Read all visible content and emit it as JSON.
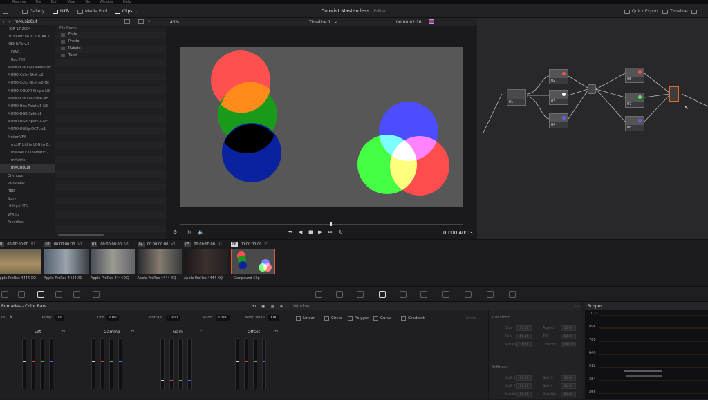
{
  "menubar": {
    "items": [
      "Resolve",
      "File",
      "Edit",
      "View",
      "Go",
      "Window",
      "Help"
    ]
  },
  "toolbar": {
    "gallery": "Gallery",
    "luts": "LUTs",
    "media_pool": "Media Pool",
    "clips": "Clips",
    "project_title": "Colorist Masterclass",
    "project_status": "Edited",
    "quick_export": "Quick Export",
    "timeline": "Timeline"
  },
  "lut_browser": {
    "folder": "mMusicCut",
    "column_header": "File Name",
    "tree": [
      {
        "label": "HGR 17.2084",
        "sub": false
      },
      {
        "label": "INTERMEDIATE KODAK 2...",
        "sub": false
      },
      {
        "label": "KB3 LUTs v.3",
        "sub": false
      },
      {
        "label": "DWG",
        "sub": true
      },
      {
        "label": "Rec.709",
        "sub": true
      },
      {
        "label": "MONO-COLOR-Double-NE",
        "sub": false
      },
      {
        "label": "MONO-Color-Shift-v2",
        "sub": false
      },
      {
        "label": "MONO-Color-Shift-v2-NE",
        "sub": false
      },
      {
        "label": "MONO-COLOR-Single-NE",
        "sub": false
      },
      {
        "label": "MONO-COLOR-Triple-NE",
        "sub": false
      },
      {
        "label": "MONO-Hue-Twist-v1-NE",
        "sub": false
      },
      {
        "label": "MONO-RGB-Split-v1",
        "sub": false
      },
      {
        "label": "MONO-RGB-Split-v1-NE",
        "sub": false
      },
      {
        "label": "MONO-Utility-DCTL-v1",
        "sub": false
      },
      {
        "label": "MotionVFX",
        "sub": false
      },
      {
        "label": "mLUT Utility LOG to 8...",
        "sub": true
      },
      {
        "label": "mMake it Cinematic 2...",
        "sub": true
      },
      {
        "label": "mMatrix",
        "sub": true
      },
      {
        "label": "mMusicCut",
        "sub": true,
        "selected": true
      },
      {
        "label": "Olympus",
        "sub": false
      },
      {
        "label": "Panasonic",
        "sub": false
      },
      {
        "label": "RED",
        "sub": false
      },
      {
        "label": "Sony",
        "sub": false
      },
      {
        "label": "Utility-LUTS",
        "sub": false
      },
      {
        "label": "VFX IO",
        "sub": false
      },
      {
        "label": "Favorites",
        "sub": false
      }
    ],
    "files": [
      "Forte",
      "Presto",
      "Rubato",
      "Tacet"
    ]
  },
  "viewer": {
    "zoom": "45%",
    "timeline_name": "Timeline 1",
    "timecode": "00:00:02:16",
    "playhead_timecode": "00:00:40:03"
  },
  "node_graph": {
    "nodes": [
      "01",
      "02",
      "03",
      "04",
      "05",
      "07",
      "08"
    ]
  },
  "clips": [
    {
      "num": "01",
      "tc": "00:00:00:00",
      "track": "V1",
      "codec": "Apple ProRes 4444 XQ"
    },
    {
      "num": "02",
      "tc": "00:00:00:00",
      "track": "V1",
      "codec": "Apple ProRes 4444 XQ"
    },
    {
      "num": "03",
      "tc": "00:00:00:00",
      "track": "V1",
      "codec": "Apple ProRes 4444 XQ"
    },
    {
      "num": "04",
      "tc": "00:00:00:00",
      "track": "V1",
      "codec": "Apple ProRes 4444 XQ"
    },
    {
      "num": "05",
      "tc": "00:00:00:00",
      "track": "V1",
      "codec": "Apple ProRes 4444 XQ"
    },
    {
      "num": "06",
      "tc": "00:00:00:00",
      "track": "V1",
      "codec": "Compound Clip"
    }
  ],
  "primaries": {
    "title": "Primaries - Color Bars",
    "params": [
      {
        "label": "Temp",
        "value": "0.0"
      },
      {
        "label": "Tint",
        "value": "0.00"
      },
      {
        "label": "Contrast",
        "value": "1.000"
      },
      {
        "label": "Pivot",
        "value": "0.000"
      },
      {
        "label": "Mid/Detail",
        "value": "0.00"
      }
    ],
    "wheels": [
      "Lift",
      "Gamma",
      "Gain",
      "Offset"
    ]
  },
  "window_panel": {
    "title": "Window",
    "tools": [
      "Linear",
      "Circle",
      "Polygon",
      "Curve",
      "Gradient"
    ],
    "delete": "Delete",
    "transform_title": "Transform",
    "transform": [
      {
        "label": "Size",
        "value": "50.00"
      },
      {
        "label": "Aspect",
        "value": "50.00"
      },
      {
        "label": "Pan",
        "value": "50.00"
      },
      {
        "label": "Tilt",
        "value": "50.00"
      },
      {
        "label": "Rotate",
        "value": "0.00"
      },
      {
        "label": "Opacity",
        "value": "100.00"
      }
    ],
    "softness_title": "Softness",
    "softness": [
      {
        "label": "Soft 1",
        "value": "50.00"
      },
      {
        "label": "Soft 3",
        "value": "50.00"
      },
      {
        "label": "Soft 2",
        "value": "50.00"
      },
      {
        "label": "Soft 4",
        "value": "50.00"
      },
      {
        "label": "Inside",
        "value": "50.00"
      },
      {
        "label": "Outside",
        "value": "50.00"
      }
    ]
  },
  "scopes": {
    "title": "Scopes",
    "scale": [
      "1023",
      "896",
      "768",
      "640",
      "512",
      "384",
      "256"
    ]
  }
}
